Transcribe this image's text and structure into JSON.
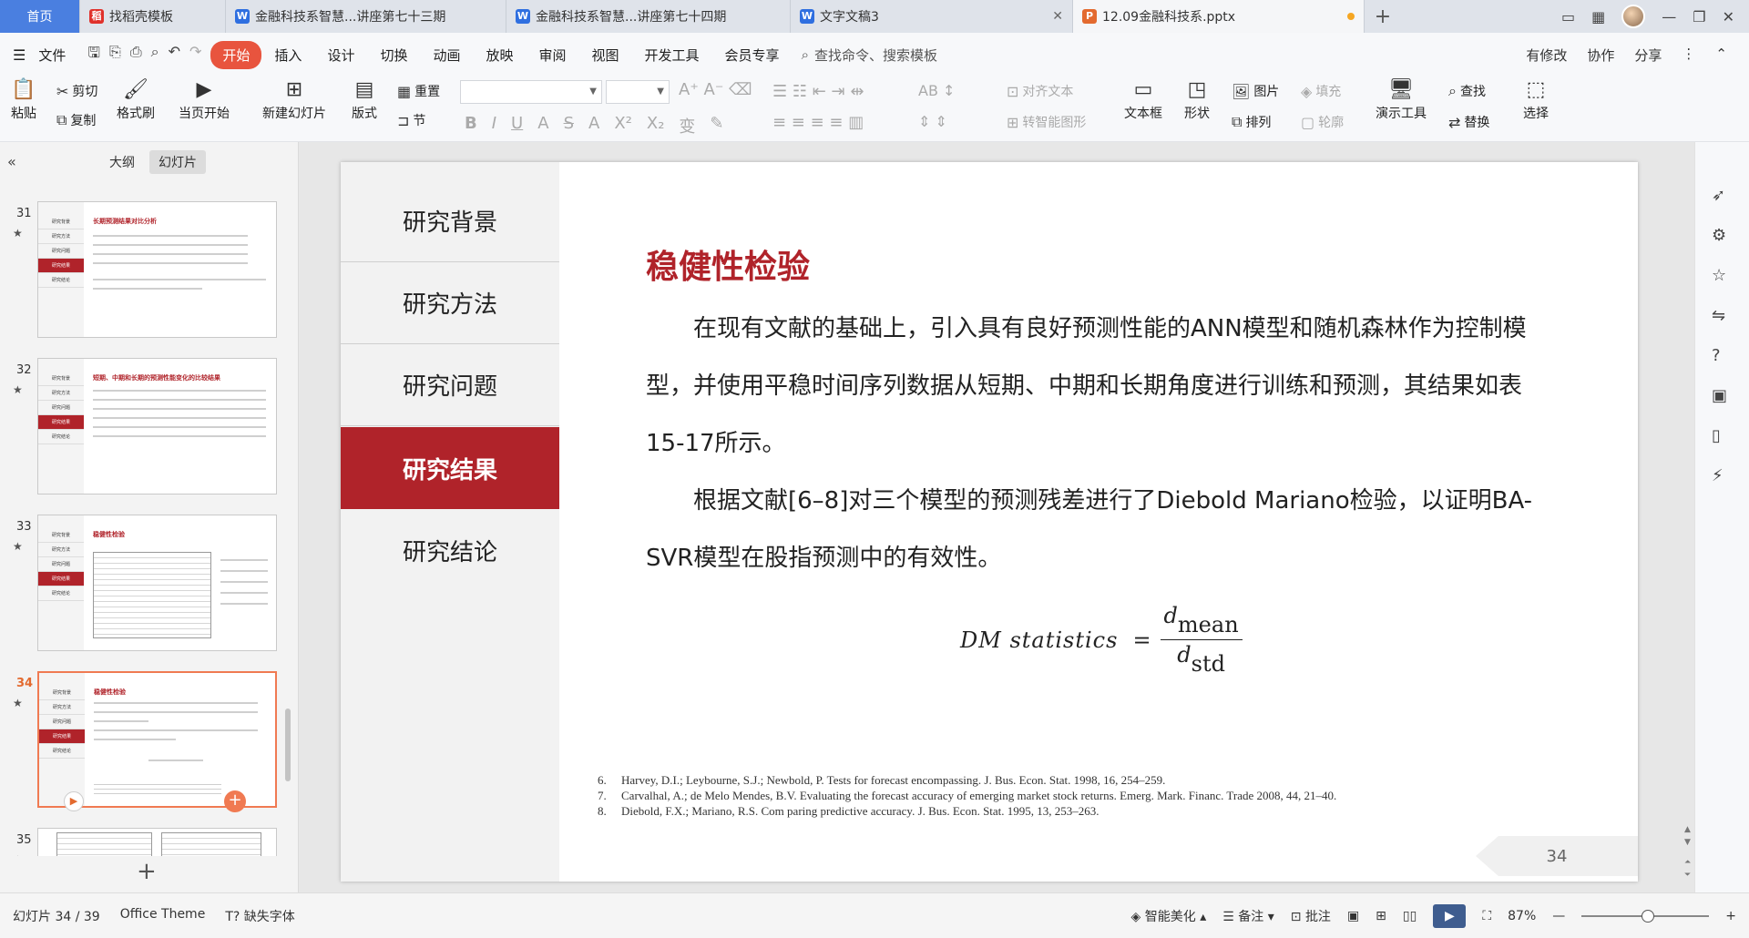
{
  "tabs": [
    {
      "label": "首页",
      "kind": "home"
    },
    {
      "label": "找稻壳模板",
      "kind": "docer"
    },
    {
      "label": "金融科技系智慧...讲座第七十三期",
      "kind": "word"
    },
    {
      "label": "金融科技系智慧...讲座第七十四期",
      "kind": "word"
    },
    {
      "label": "文字文稿3",
      "kind": "word"
    },
    {
      "label": "12.09金融科技系.pptx",
      "kind": "ppt"
    }
  ],
  "menu": {
    "file": "文件",
    "items": [
      "开始",
      "插入",
      "设计",
      "切换",
      "动画",
      "放映",
      "审阅",
      "视图",
      "开发工具",
      "会员专享"
    ],
    "search": "查找命令、搜索模板",
    "right": [
      "有修改",
      "协作",
      "分享"
    ]
  },
  "ribbon": {
    "paste": "粘贴",
    "cut": "剪切",
    "copy": "复制",
    "format_painter": "格式刷",
    "from_current": "当页开始",
    "new_slide": "新建幻灯片",
    "layout": "版式",
    "reset": "重置",
    "section": "节",
    "align_text": "对齐文本",
    "smartart": "转智能图形",
    "textbox": "文本框",
    "shape": "形状",
    "picture": "图片",
    "fill": "填充",
    "arrange": "排列",
    "outline": "轮廓",
    "present_tools": "演示工具",
    "find": "查找",
    "replace": "替换",
    "select": "选择"
  },
  "left_panel": {
    "tab_outline": "大纲",
    "tab_slides": "幻灯片",
    "thumbnails": [
      {
        "num": "31",
        "title": "长期预测结果对比分析"
      },
      {
        "num": "32",
        "title": "短期、中期和长期的预测性能变化的比较结果"
      },
      {
        "num": "33",
        "title": "稳健性检验"
      },
      {
        "num": "34",
        "title": "稳健性检验"
      },
      {
        "num": "35",
        "title": ""
      }
    ],
    "nav_labels": [
      "研究背景",
      "研究方法",
      "研究问题",
      "研究结果",
      "研究结论"
    ]
  },
  "slide": {
    "nav": [
      "研究背景",
      "研究方法",
      "研究问题",
      "研究结果",
      "研究结论"
    ],
    "active_nav": "研究结果",
    "title": "稳健性检验",
    "paragraph1": "在现有文献的基础上，引入具有良好预测性能的ANN模型和随机森林作为控制模型，并使用平稳时间序列数据从短期、中期和长期角度进行训练和预测，其结果如表15-17所示。",
    "paragraph2": "根据文献[6–8]对三个模型的预测残差进行了Diebold Mariano检验，以证明BA-SVR模型在股指预测中的有效性。",
    "formula": {
      "lhs": "DM statistics",
      "eq": "=",
      "num_var": "d",
      "num_sub": "mean",
      "den_var": "d",
      "den_sub": "std"
    },
    "references": [
      {
        "n": "6.",
        "text": "Harvey, D.I.; Leybourne, S.J.; Newbold, P. Tests for forecast encompassing. J. Bus. Econ. Stat. 1998, 16, 254–259."
      },
      {
        "n": "7.",
        "text": "Carvalhal, A.; de Melo Mendes, B.V. Evaluating the forecast accuracy of emerging market stock returns. Emerg. Mark. Financ. Trade 2008, 44, 21–40."
      },
      {
        "n": "8.",
        "text": "Diebold, F.X.; Mariano, R.S. Com paring predictive accuracy. J. Bus. Econ. Stat. 1995, 13, 253–263."
      }
    ],
    "page_number": "34"
  },
  "status": {
    "slide_count": "幻灯片 34 / 39",
    "theme": "Office Theme",
    "missing_font": "缺失字体",
    "beautify": "智能美化",
    "notes": "备注",
    "comments": "批注",
    "zoom": "87%"
  },
  "colors": {
    "accent_red": "#b0232a",
    "start_tab": "#e8543e",
    "home_tab": "#4a7fe0",
    "active_thumb": "#f07a52"
  }
}
